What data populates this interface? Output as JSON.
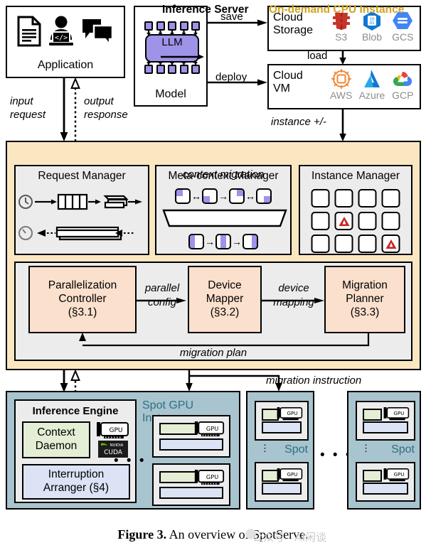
{
  "application": {
    "label": "Application",
    "icons": [
      "document-icon",
      "developer-icon",
      "chat-bubbles-icon"
    ]
  },
  "model": {
    "label": "Model",
    "core_label": "LLM",
    "node_count_top": 5,
    "node_count_bottom": 5,
    "core_color": "#9d93e8"
  },
  "cloud_storage": {
    "title": "Cloud\nStorage",
    "title_line1": "Cloud",
    "title_line2": "Storage",
    "vendors": [
      {
        "name": "S3",
        "icon": "aws-s3-icon",
        "color": "#c6352a"
      },
      {
        "name": "Blob",
        "icon": "azure-blob-icon",
        "color": "#0f78d4"
      },
      {
        "name": "GCS",
        "icon": "google-cloud-storage-icon",
        "color": "#4285f4"
      }
    ]
  },
  "cloud_vm": {
    "title_line1": "Cloud",
    "title_line2": "VM",
    "vendors": [
      {
        "name": "AWS",
        "icon": "aws-ec2-icon",
        "color": "#f58536"
      },
      {
        "name": "Azure",
        "icon": "azure-icon",
        "color": "#0f78d4"
      },
      {
        "name": "GCP",
        "icon": "google-cloud-icon",
        "color": "#ea4335"
      }
    ]
  },
  "edges": {
    "input_request": "input\nrequest",
    "input_request_l1": "input",
    "input_request_l2": "request",
    "output_response_l1": "output",
    "output_response_l2": "response",
    "save": "save",
    "deploy": "deploy",
    "load": "load",
    "instance_pm": "instance +/-",
    "parallel_l1": "parallel",
    "parallel_l2": "config",
    "device_l1": "device",
    "device_l2": "mapping",
    "migration_plan": "migration plan",
    "migration_instruction": "migration instruction"
  },
  "inference_server": {
    "title": "Inference Server",
    "instance_type": "On-demand CPU Instance",
    "instance_type_color": "#d0a520",
    "panel_color": "#fbe6c2",
    "request_manager": {
      "title": "Request Manager",
      "row1_icon": "clock-icon",
      "row2_icon": "clock-icon"
    },
    "meta_context_manager": {
      "title": "Meta-context Manager",
      "banner": "context migration",
      "row1_blocks": 4,
      "row2_blocks": 3
    },
    "instance_manager": {
      "title": "Instance Manager",
      "rows": 3,
      "cols": 4,
      "alert_cells": [
        [
          1,
          1
        ],
        [
          2,
          3
        ]
      ],
      "alert_icon": "warning-triangle-icon",
      "alert_color": "#cc2222"
    },
    "planners": [
      {
        "name": "Parallelization Controller",
        "line1": "Parallelization",
        "line2": "Controller",
        "section": "(§3.1)"
      },
      {
        "name": "Device Mapper",
        "line1": "Device",
        "line2": "Mapper",
        "section": "(§3.2)"
      },
      {
        "name": "Migration Planner",
        "line1": "Migration",
        "line2": "Planner",
        "section": "(§3.3)"
      }
    ],
    "planner_box_color": "#fbe0cd"
  },
  "spot": {
    "panel_color": "#a8c4ce",
    "label": "Spot GPU Instance",
    "label_color": "#2f6f82",
    "spot_tag": "Spot",
    "inference_engine": {
      "title": "Inference Engine",
      "context_daemon_l1": "Context",
      "context_daemon_l2": "Daemon",
      "context_daemon_color": "#e3eed4",
      "interruption_l1": "Interruption",
      "interruption_l2": "Arranger (§4)",
      "interruption_color": "#dbe3f5",
      "gpu_icon": "gpu-card-icon",
      "cuda_badge": "CUDA",
      "cuda_brand": "NVIDIA"
    },
    "gpu_label": "GPU",
    "ellipsis": "• • •"
  },
  "caption": {
    "prefix": "Figure 3.",
    "text": " An overview of SpotServe.",
    "watermark": "公众号 · AI闲谈"
  }
}
